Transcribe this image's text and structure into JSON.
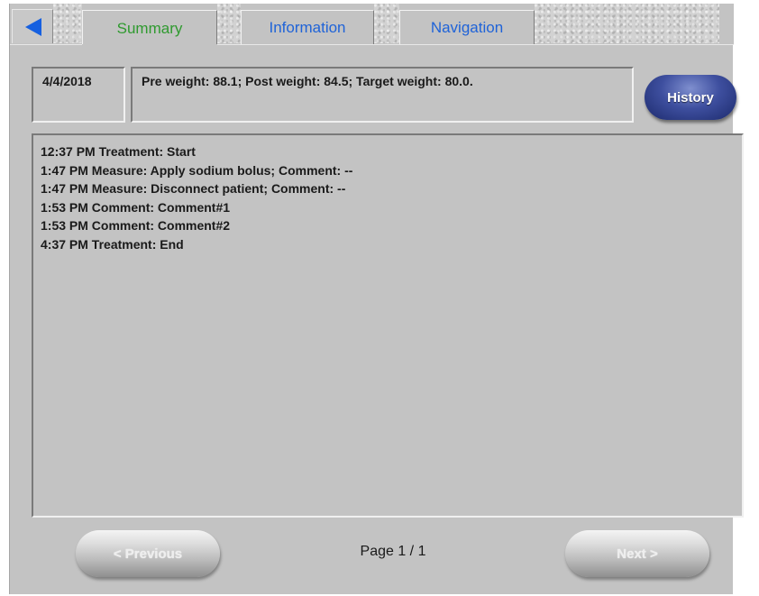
{
  "tabs": [
    {
      "label": "Summary",
      "active": true
    },
    {
      "label": "Information",
      "active": false
    },
    {
      "label": "Navigation",
      "active": false
    }
  ],
  "back_icon": "triangle-left-icon",
  "colors": {
    "active_tab": "#2f9a2f",
    "inactive_tab": "#1f63d8",
    "history_button": "#2f3f8f",
    "back_arrow": "#1660e0",
    "panel_background": "#c3c3c3"
  },
  "header": {
    "date": "4/4/2018",
    "summary": "Pre weight: 88.1; Post weight: 84.5; Target weight: 80.0."
  },
  "history_label": "History",
  "log_entries": [
    "12:37 PM Treatment: Start",
    "1:47 PM Measure: Apply sodium bolus; Comment: --",
    "1:47 PM Measure: Disconnect patient; Comment: --",
    "1:53 PM Comment: Comment#1",
    "1:53 PM Comment: Comment#2",
    "4:37 PM Treatment: End"
  ],
  "footer": {
    "previous_label": "< Previous",
    "next_label": "Next >",
    "page_label": "Page 1 / 1"
  }
}
